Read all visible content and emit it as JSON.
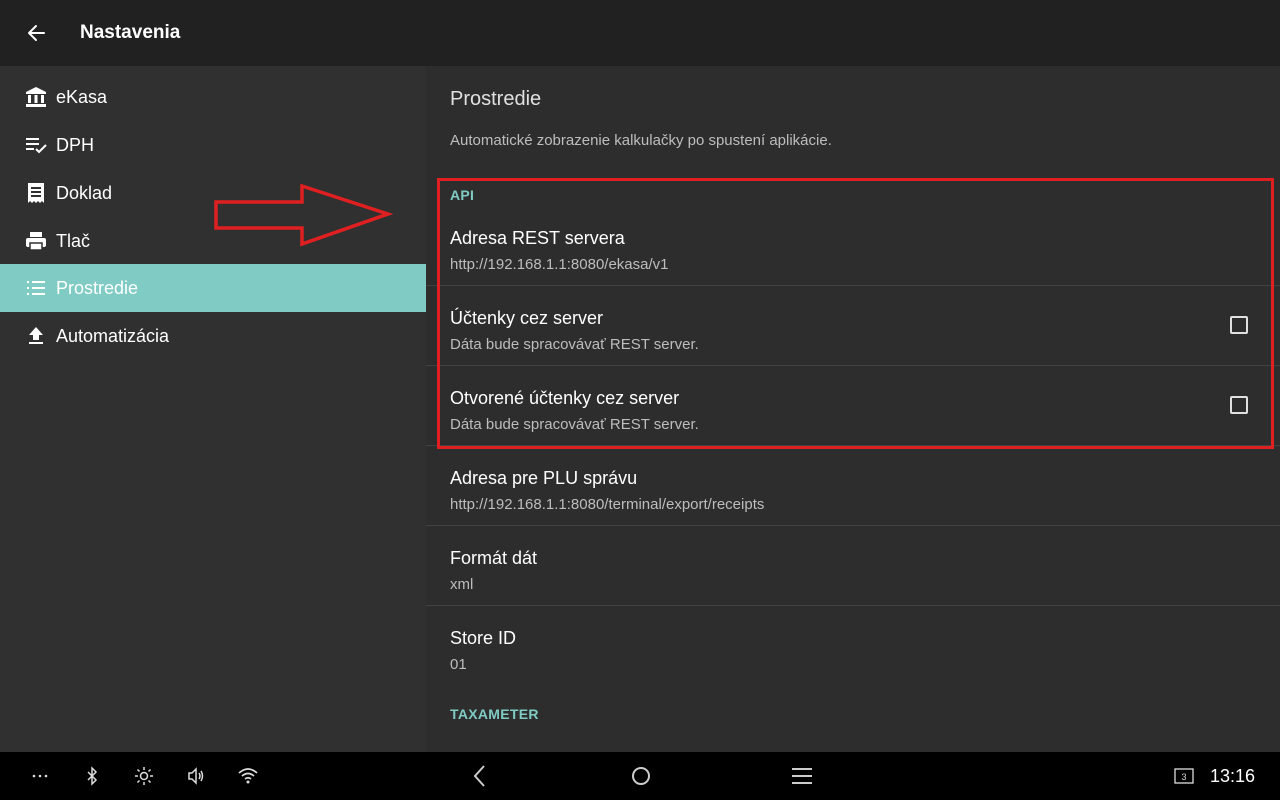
{
  "app": {
    "title": "Nastavenia"
  },
  "sidebar": {
    "items": [
      {
        "label": "eKasa",
        "icon": "bank-icon",
        "active": false
      },
      {
        "label": "DPH",
        "icon": "list-check-icon",
        "active": false
      },
      {
        "label": "Doklad",
        "icon": "receipt-icon",
        "active": false
      },
      {
        "label": "Tlač",
        "icon": "printer-icon",
        "active": false
      },
      {
        "label": "Prostredie",
        "icon": "list-icon",
        "active": true
      },
      {
        "label": "Automatizácia",
        "icon": "upload-icon",
        "active": false
      }
    ]
  },
  "content": {
    "section_title": "Prostredie",
    "cutoff_text": "Automatické zobrazenie kalkulačky po spustení aplikácie.",
    "api_header": "API",
    "prefs": [
      {
        "title": "Adresa REST servera",
        "summary": "http://192.168.1.1:8080/ekasa/v1",
        "checkbox": null
      },
      {
        "title": "Účtenky cez server",
        "summary": "Dáta bude spracovávať REST server.",
        "checkbox": false
      },
      {
        "title": "Otvorené účtenky cez server",
        "summary": "Dáta bude spracovávať REST server.",
        "checkbox": false
      },
      {
        "title": "Adresa pre PLU správu",
        "summary": "http://192.168.1.1:8080/terminal/export/receipts",
        "checkbox": null
      },
      {
        "title": "Formát dát",
        "summary": "xml",
        "checkbox": null
      },
      {
        "title": "Store ID",
        "summary": "01",
        "checkbox": null
      }
    ],
    "taxameter_header": "TAXAMETER"
  },
  "navbar": {
    "clock": "13:16",
    "badge": "3"
  },
  "colors": {
    "accent": "#80cbc4",
    "highlight": "#e02020",
    "topbar": "#212121",
    "background": "#303030"
  }
}
